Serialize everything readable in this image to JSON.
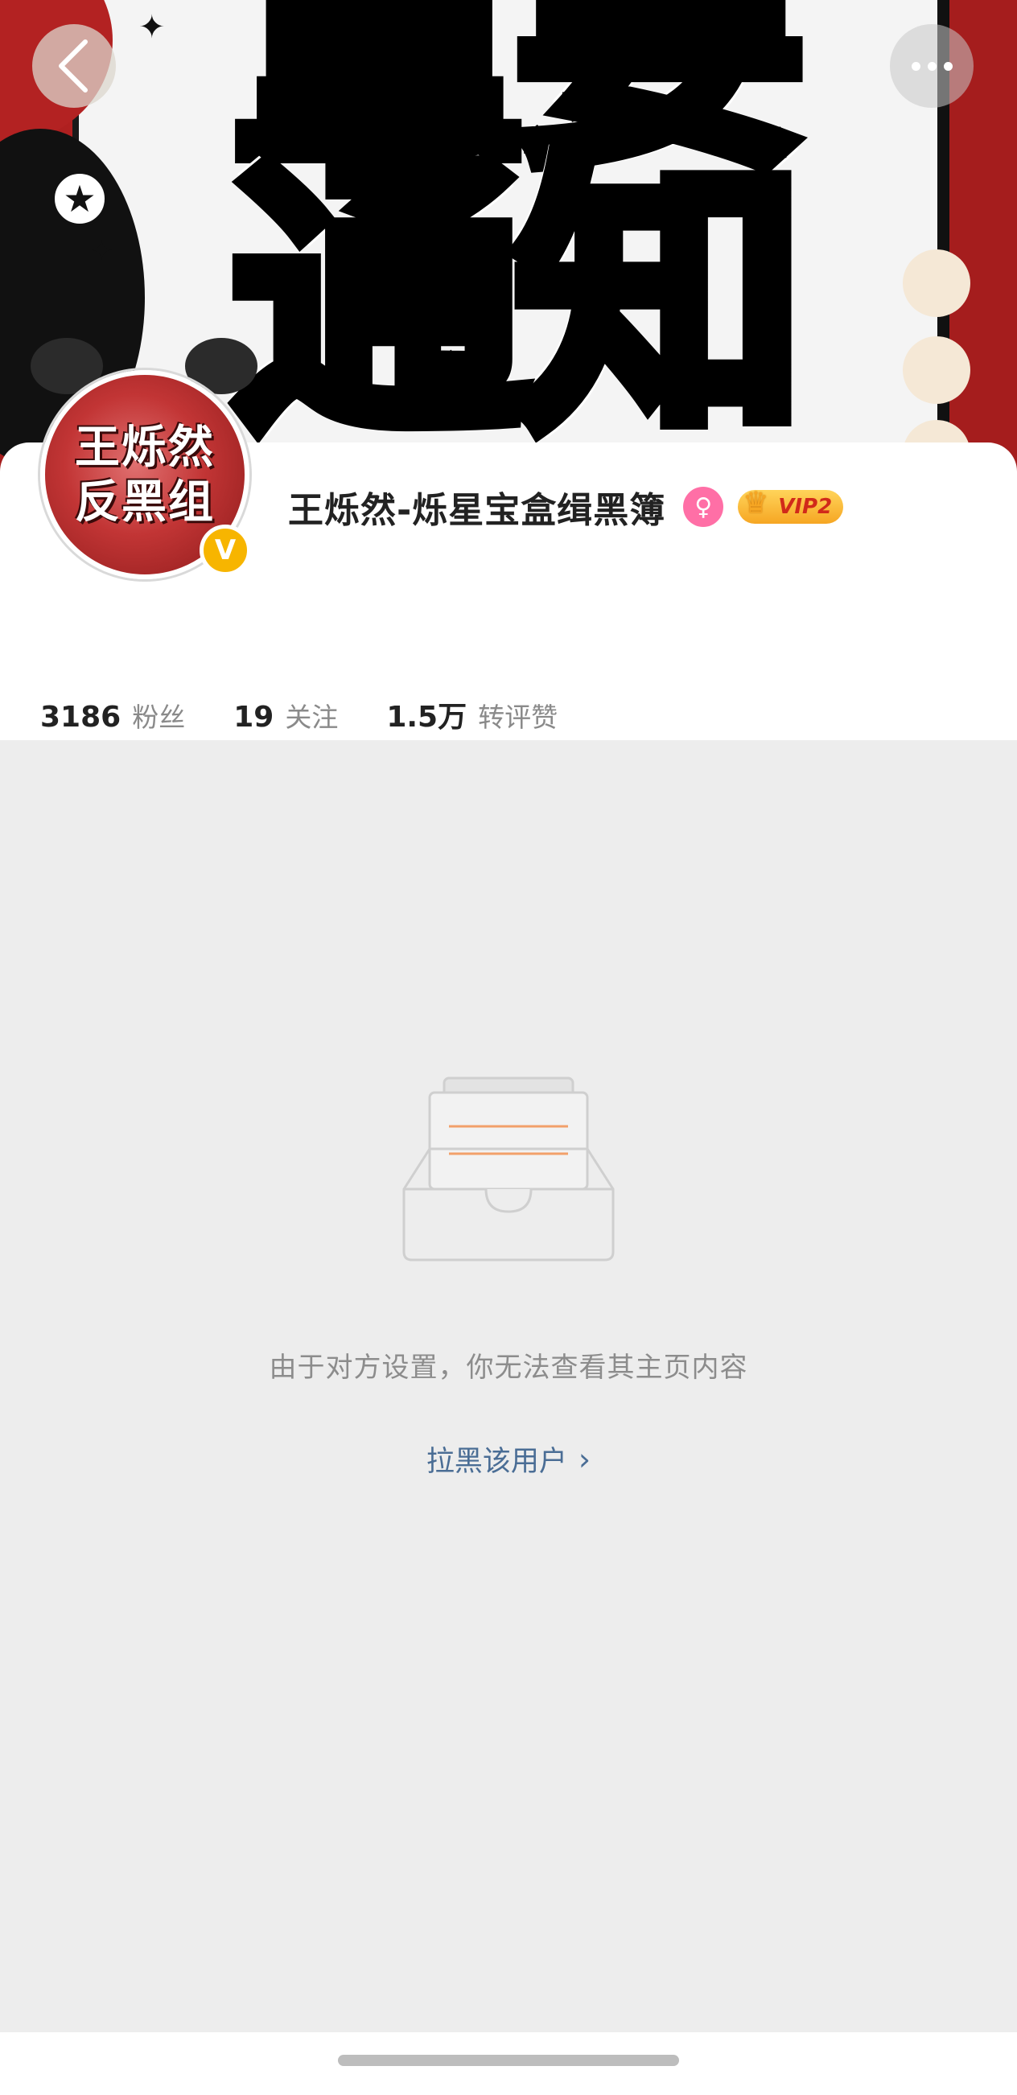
{
  "cover": {
    "text_line1": "重要",
    "text_line2": "通知"
  },
  "avatar": {
    "line1": "王烁然",
    "line2": "反黑组",
    "verified_mark": "V"
  },
  "profile": {
    "username": "王烁然-烁星宝盒缉黑簿",
    "vip_label": "VIP2",
    "stats": [
      {
        "value": "3186",
        "label": "粉丝"
      },
      {
        "value": "19",
        "label": "关注"
      },
      {
        "value": "1.5万",
        "label": "转评赞"
      }
    ]
  },
  "empty_state": {
    "message": "由于对方设置，你无法查看其主页内容",
    "action_label": "拉黑该用户"
  },
  "colors": {
    "background": "#ededed",
    "link": "#4a6d95",
    "verified": "#f7b500",
    "female_badge": "#ff6fa6"
  }
}
